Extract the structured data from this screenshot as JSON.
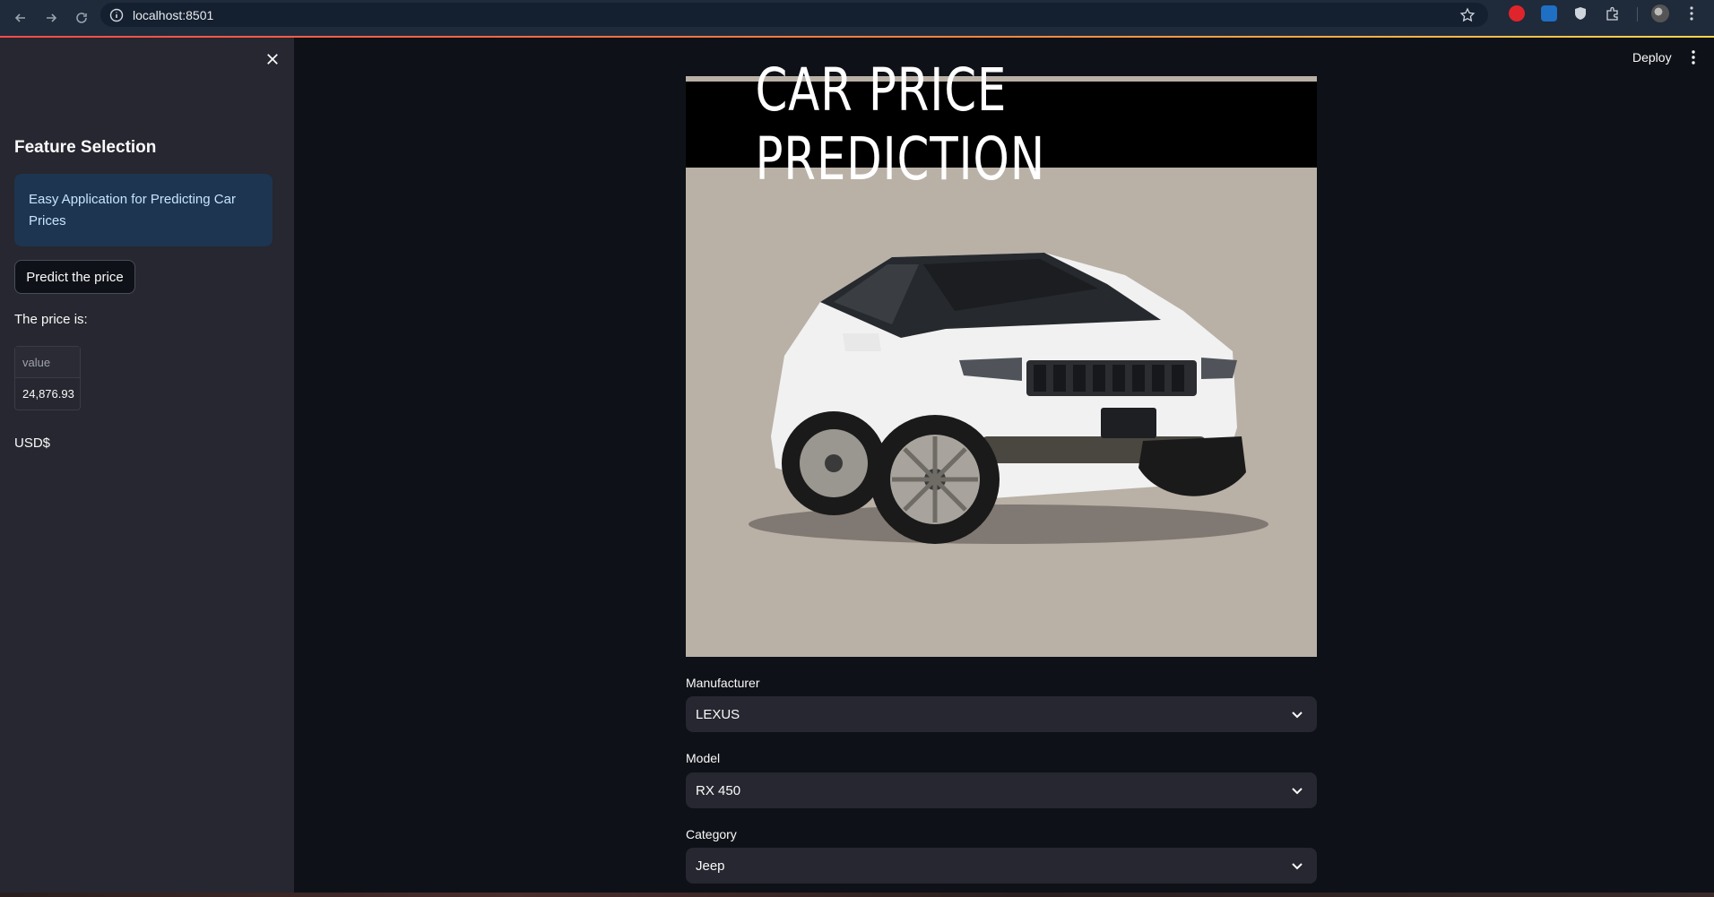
{
  "browser": {
    "url": "localhost:8501"
  },
  "sidebar": {
    "title": "Feature Selection",
    "info_text": "Easy Application for Predicting Car Prices",
    "predict_button": "Predict the price",
    "price_label": "The price is:",
    "table": {
      "header": "value",
      "value": "24,876.93"
    },
    "currency": "USD$"
  },
  "header": {
    "deploy_label": "Deploy"
  },
  "hero": {
    "title": "CAR PRICE PREDICTION"
  },
  "form": {
    "manufacturer": {
      "label": "Manufacturer",
      "value": "LEXUS"
    },
    "model": {
      "label": "Model",
      "value": "RX 450"
    },
    "category": {
      "label": "Category",
      "value": "Jeep"
    }
  },
  "colors": {
    "accent_gradient": [
      "#ff4b4b",
      "#ffd84b"
    ],
    "sidebar_bg": "#262730",
    "main_bg": "#0e1117",
    "info_bg": "#1d3550"
  }
}
